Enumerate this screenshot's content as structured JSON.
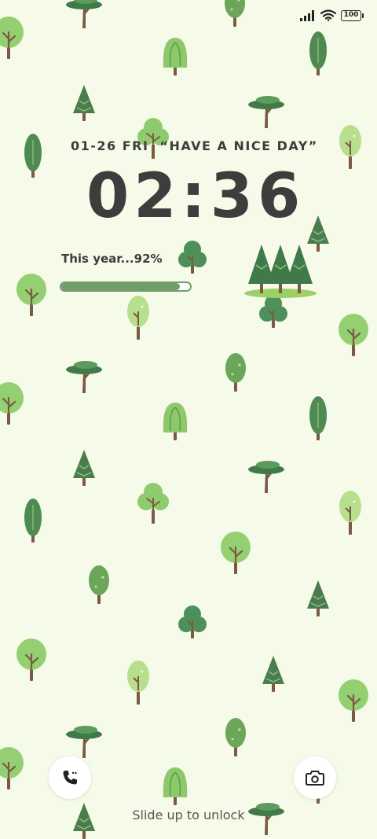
{
  "status_bar": {
    "battery_level": "100",
    "signal_icon": "signal-bars-icon",
    "wifi_icon": "wifi-icon"
  },
  "lock_screen": {
    "date": "01-26 FRI",
    "quote": "“HAVE A NICE DAY”",
    "time": "02:36",
    "year_progress_label": "This year...92%",
    "year_progress_percent": 92
  },
  "shortcuts": {
    "phone_icon": "phone-icon",
    "camera_icon": "camera-icon"
  },
  "unlock_hint": "Slide up to unlock",
  "colors": {
    "background": "#f5fbe8",
    "text": "#3d3d3d",
    "progress": "#6f9e6a"
  }
}
